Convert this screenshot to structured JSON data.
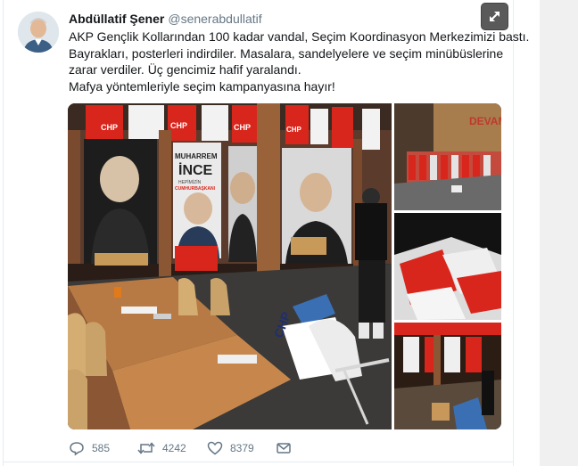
{
  "tweet": {
    "display_name": "Abdüllatif Şener",
    "handle": "@senerabdullatif",
    "text_lines": [
      "AKP Gençlik Kollarından 100 kadar vandal, Seçim Koordinasyon Merkezimizi bastı.",
      "Bayrakları, posterleri indirdiler. Masalara, sandelyelere ve seçim minübüslerine",
      "zarar verdiler. Üç gencimiz hafif yaralandı.",
      "Mafya yöntemleriyle seçim kampanyasına hayır!"
    ],
    "media": {
      "photo_texts": {
        "flag_label": "CHP",
        "poster_name_top": "MUHARREM",
        "poster_name_big": "İNCE",
        "poster_sub_1": "HEPİMİZİN",
        "poster_sub_2": "CUMHURBAŞKANI",
        "wall_text": "DEVAM",
        "chair_label": "CHP"
      }
    },
    "actions": {
      "replies": "585",
      "retweets": "4242",
      "likes": "8379"
    }
  },
  "colors": {
    "chp_red": "#d9261c",
    "text_primary": "#14171a",
    "text_secondary": "#657786"
  },
  "icons": [
    "expand-icon",
    "reply-icon",
    "retweet-icon",
    "like-icon",
    "message-icon"
  ]
}
